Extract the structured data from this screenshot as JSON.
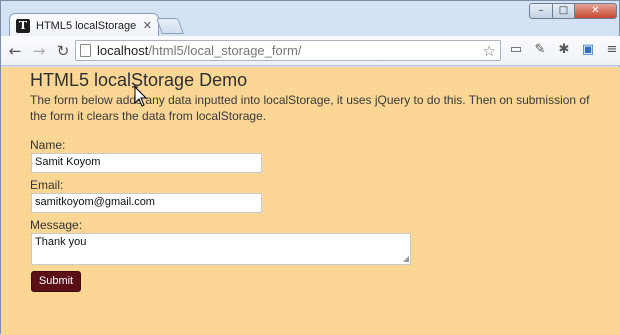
{
  "browser": {
    "tab_title": "HTML5 localStorage Demo",
    "tab_favicon_letter": "T",
    "tab_close": "✕",
    "address_host": "localhost",
    "address_path": "/html5/local_storage_form/",
    "back_icon": "arrow-left-icon",
    "forward_icon": "arrow-right-icon",
    "reload_icon": "reload-icon",
    "window_controls": [
      "–",
      "□",
      "✕"
    ]
  },
  "page": {
    "title": "HTML5 localStorage Demo",
    "intro": "The form below adds any data inputted into localStorage, it uses jQuery to do this. Then on submission of the form it clears the data from localStorage.",
    "form": {
      "name_label": "Name:",
      "name_value": "Samit Koyom",
      "email_label": "Email:",
      "email_value": "samitkoyom@gmail.com",
      "message_label": "Message:",
      "message_value": "Thank you",
      "submit_label": "Submit"
    }
  },
  "colors": {
    "page_background": "#fbd592",
    "submit_button": "#5a1016"
  }
}
